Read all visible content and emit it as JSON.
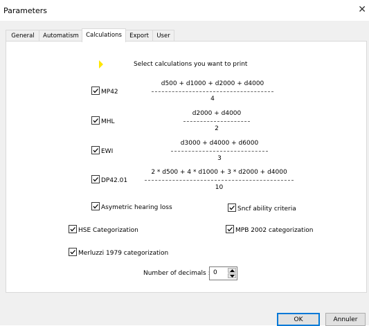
{
  "window": {
    "title": "Parameters",
    "close_glyph": "✕"
  },
  "tabs": [
    {
      "label": "General",
      "active": false
    },
    {
      "label": "Automatism",
      "active": false
    },
    {
      "label": "Calculations",
      "active": true
    },
    {
      "label": "Export",
      "active": false
    },
    {
      "label": "User",
      "active": false
    }
  ],
  "calc": {
    "heading": "Select calculations you want to print",
    "formulas": [
      {
        "label": "MP42",
        "checked": true,
        "numerator": "d500 + d1000 + d2000 + d4000",
        "denominator": "4"
      },
      {
        "label": "MHL",
        "checked": true,
        "numerator": "d2000 + d4000",
        "denominator": "2"
      },
      {
        "label": "EWI",
        "checked": true,
        "numerator": "d3000 + d4000 + d6000",
        "denominator": "3"
      },
      {
        "label": "DP42.01",
        "checked": true,
        "numerator": "2 * d500 + 4 * d1000 + 3 * d2000 + d4000",
        "denominator": "10"
      }
    ],
    "options": {
      "asymetric": {
        "label": "Asymetric hearing loss",
        "checked": true
      },
      "sncf": {
        "label": "Sncf ability criteria",
        "checked": true
      },
      "hse": {
        "label": "HSE Categorization",
        "checked": true
      },
      "mpb": {
        "label": "MPB 2002 categorization",
        "checked": true
      },
      "merluzzi": {
        "label": "Merluzzi 1979 categorization",
        "checked": true
      }
    },
    "decimals": {
      "label": "Number of decimals :",
      "value": "0"
    }
  },
  "buttons": {
    "ok": "OK",
    "cancel": "Annuler"
  },
  "colors": {
    "accent": "#0078d7",
    "pointer": "#ffe600"
  }
}
